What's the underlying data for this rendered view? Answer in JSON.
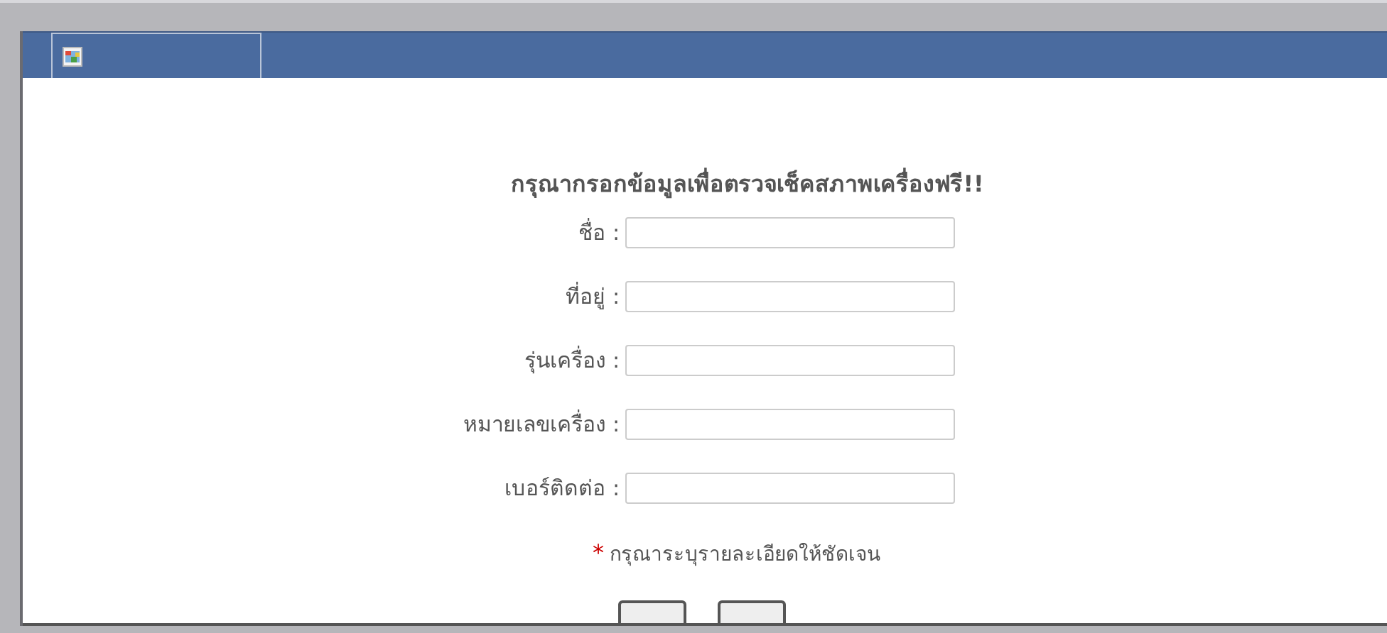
{
  "header": {
    "tabs": [
      {
        "kind": "picture-tab"
      }
    ]
  },
  "form": {
    "title": "กรุณากรอกข้อมูลเพื่อตรวจเช็คสภาพเครื่องฟรี!!",
    "fields": [
      {
        "label": "ชื่อ :"
      },
      {
        "label": "ที่อยู่ :"
      },
      {
        "label": "รุ่นเครื่อง :"
      },
      {
        "label": "หมายเลขเครื่อง :"
      },
      {
        "label": "เบอร์ติดต่อ :"
      }
    ],
    "note": {
      "mark": "*",
      "text": "กรุณาระบุรายละเอียดให้ชัดเจน"
    },
    "buttons": [
      {
        "kind": "button"
      },
      {
        "kind": "button"
      }
    ]
  }
}
